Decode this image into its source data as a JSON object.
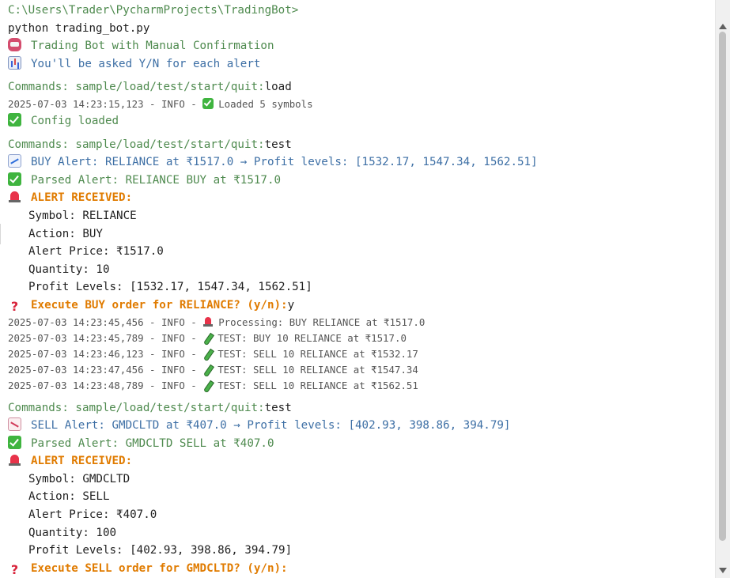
{
  "terminal": {
    "cwd_prompt": "C:\\Users\\Trader\\PycharmProjects\\TradingBot>",
    "command": "python trading_bot.py",
    "banner_title": "Trading Bot with Manual Confirmation",
    "banner_sub": "You'll be asked Y/N for each alert",
    "commands_prompt": "Commands: sample/load/test/start/quit:",
    "session1": {
      "input": "load",
      "log": "2025-07-03 14:23:15,123 - INFO - ",
      "log_msg": "Loaded 5 symbols",
      "status": "Config loaded"
    },
    "session2": {
      "input": "test",
      "alert_line": "BUY Alert: RELIANCE at ₹1517.0 → Profit levels: [1532.17, 1547.34, 1562.51]",
      "parsed": "Parsed Alert: RELIANCE BUY at ₹1517.0",
      "received": "ALERT RECEIVED:",
      "symbol": "Symbol: RELIANCE",
      "action": "Action: BUY",
      "price": "Alert Price: ₹1517.0",
      "quantity": "Quantity: 10",
      "levels": "Profit Levels: [1532.17, 1547.34, 1562.51]",
      "question": "Execute BUY order for RELIANCE? (y/n):",
      "answer": "y",
      "logs": [
        {
          "prefix": "2025-07-03 14:23:45,456 - INFO - ",
          "msg": "Processing: BUY RELIANCE at ₹1517.0",
          "icon": "siren-icon"
        },
        {
          "prefix": "2025-07-03 14:23:45,789 - INFO - ",
          "msg": "TEST: BUY 10 RELIANCE at ₹1517.0",
          "icon": "test-tube-icon"
        },
        {
          "prefix": "2025-07-03 14:23:46,123 - INFO - ",
          "msg": "TEST: SELL 10 RELIANCE at ₹1532.17",
          "icon": "test-tube-icon"
        },
        {
          "prefix": "2025-07-03 14:23:47,456 - INFO - ",
          "msg": "TEST: SELL 10 RELIANCE at ₹1547.34",
          "icon": "test-tube-icon"
        },
        {
          "prefix": "2025-07-03 14:23:48,789 - INFO - ",
          "msg": "TEST: SELL 10 RELIANCE at ₹1562.51",
          "icon": "test-tube-icon"
        }
      ]
    },
    "session3": {
      "input": "test",
      "alert_line": "SELL Alert: GMDCLTD at ₹407.0 → Profit levels: [402.93, 398.86, 394.79]",
      "parsed": "Parsed Alert: GMDCLTD SELL at ₹407.0",
      "received": "ALERT RECEIVED:",
      "symbol": "Symbol: GMDCLTD",
      "action": "Action: SELL",
      "price": "Alert Price: ₹407.0",
      "quantity": "Quantity: 100",
      "levels": "Profit Levels: [402.93, 398.86, 394.79]",
      "question": "Execute SELL order for GMDCLTD? (y/n):"
    }
  },
  "colors": {
    "green": "#4e8a4e",
    "blue": "#3d6fa5",
    "orange": "#e07b00",
    "text": "#1f1f1f",
    "log": "#555555"
  }
}
